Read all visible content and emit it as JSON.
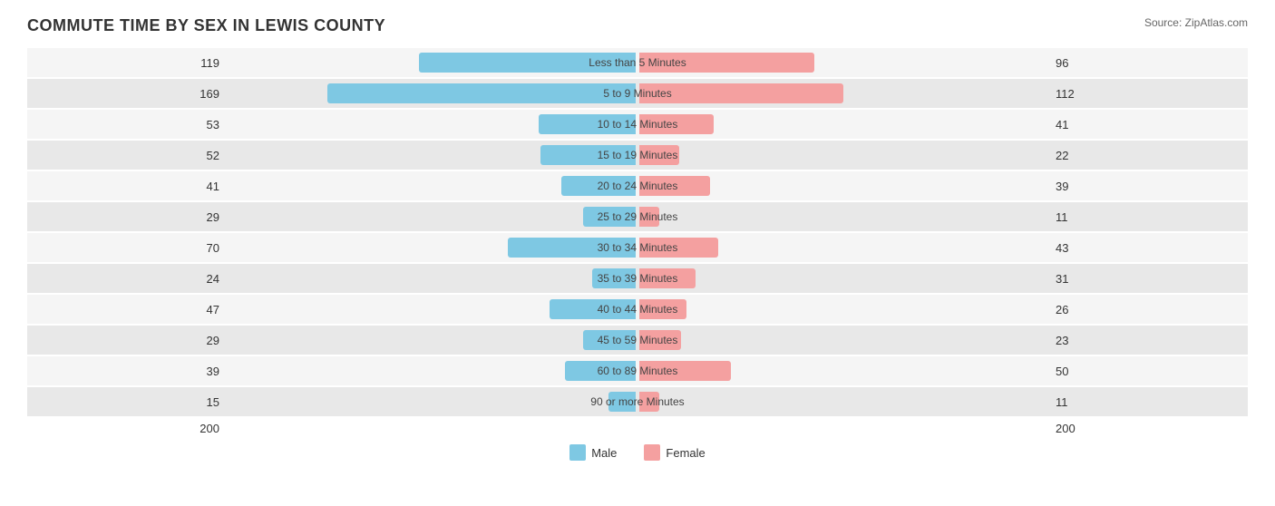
{
  "title": "COMMUTE TIME BY SEX IN LEWIS COUNTY",
  "source": "Source: ZipAtlas.com",
  "axis_label_left": "200",
  "axis_label_right": "200",
  "legend": {
    "male_label": "Male",
    "female_label": "Female",
    "male_color": "#7ec8e3",
    "female_color": "#f4a0a0"
  },
  "rows": [
    {
      "label": "Less than 5 Minutes",
      "male": 119,
      "female": 96
    },
    {
      "label": "5 to 9 Minutes",
      "male": 169,
      "female": 112
    },
    {
      "label": "10 to 14 Minutes",
      "male": 53,
      "female": 41
    },
    {
      "label": "15 to 19 Minutes",
      "male": 52,
      "female": 22
    },
    {
      "label": "20 to 24 Minutes",
      "male": 41,
      "female": 39
    },
    {
      "label": "25 to 29 Minutes",
      "male": 29,
      "female": 11
    },
    {
      "label": "30 to 34 Minutes",
      "male": 70,
      "female": 43
    },
    {
      "label": "35 to 39 Minutes",
      "male": 24,
      "female": 31
    },
    {
      "label": "40 to 44 Minutes",
      "male": 47,
      "female": 26
    },
    {
      "label": "45 to 59 Minutes",
      "male": 29,
      "female": 23
    },
    {
      "label": "60 to 89 Minutes",
      "male": 39,
      "female": 50
    },
    {
      "label": "90 or more Minutes",
      "male": 15,
      "female": 11
    }
  ],
  "max_value": 169
}
